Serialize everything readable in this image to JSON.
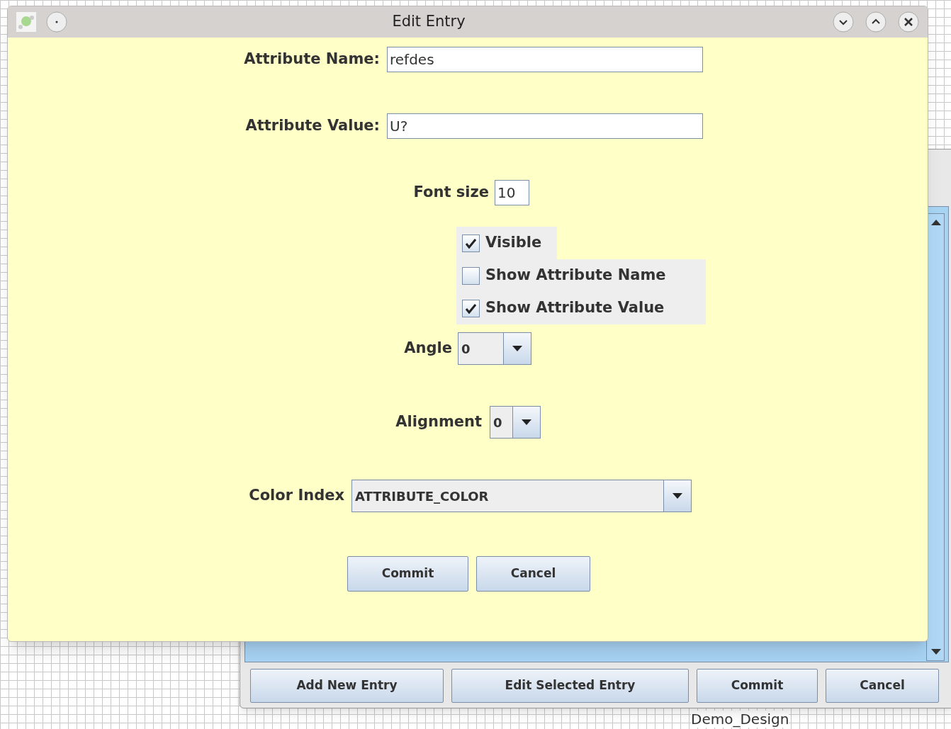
{
  "window": {
    "title": "Edit Entry"
  },
  "attribute_name": {
    "label": "Attribute Name:",
    "value": "refdes"
  },
  "attribute_value": {
    "label": "Attribute Value:",
    "value": "U?"
  },
  "font_size": {
    "label": "Font size",
    "value": "10"
  },
  "checkboxes": [
    {
      "label": "Visible",
      "checked": true
    },
    {
      "label": "Show Attribute Name",
      "checked": false
    },
    {
      "label": "Show Attribute Value",
      "checked": true
    }
  ],
  "angle": {
    "label": "Angle",
    "value": "0"
  },
  "alignment": {
    "label": "Alignment",
    "value": "0"
  },
  "color_index": {
    "label": "Color Index",
    "value": "ATTRIBUTE_COLOR"
  },
  "buttons": [
    "Commit",
    "Cancel"
  ],
  "background_window": {
    "buttons": [
      "Add New Entry",
      "Edit Selected Entry",
      "Commit",
      "Cancel"
    ]
  },
  "canvas": {
    "label": "Demo_Design"
  }
}
